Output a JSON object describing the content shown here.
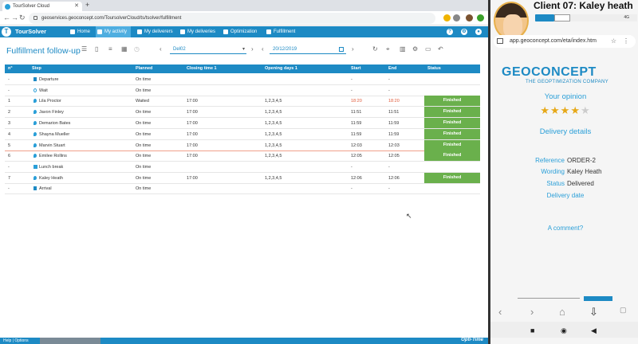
{
  "browser": {
    "tab_title": "TourSolver Cloud",
    "url": "geoservices.geoconcept.com/ToursolverCloud/ts/tsolver/fulfillment"
  },
  "app": {
    "brand": "TourSolver",
    "nav": [
      "Home",
      "My activity",
      "My deliverers",
      "My deliveries",
      "Optimization",
      "Fulfillment"
    ]
  },
  "page": {
    "title": "Fulfillment follow-up",
    "deliverer": "Del02",
    "date": "20/12/2019"
  },
  "table": {
    "headers": [
      "n°",
      "Step",
      "Planned",
      "Closing time 1",
      "Opening days 1",
      "Start",
      "End",
      "Status"
    ],
    "rows": [
      {
        "n": "-",
        "step": "Departure",
        "planned": "On time",
        "closing": "",
        "days": "",
        "start": "-",
        "end": "-",
        "status": ""
      },
      {
        "n": "-",
        "step": "Wait",
        "planned": "On time",
        "closing": "",
        "days": "",
        "start": "-",
        "end": "-",
        "status": ""
      },
      {
        "n": "1",
        "step": "Lila Proctor",
        "planned": "Waited",
        "closing": "17:00",
        "days": "1,2,3,4,5",
        "start": "18:20",
        "end": "18:20",
        "status": "Finished"
      },
      {
        "n": "2",
        "step": "Javon Finley",
        "planned": "On time",
        "closing": "17:00",
        "days": "1,2,3,4,5",
        "start": "11:51",
        "end": "11:51",
        "status": "Finished"
      },
      {
        "n": "3",
        "step": "Demarion Bates",
        "planned": "On time",
        "closing": "17:00",
        "days": "1,2,3,4,5",
        "start": "11:59",
        "end": "11:59",
        "status": "Finished"
      },
      {
        "n": "4",
        "step": "Shayna Mueller",
        "planned": "On time",
        "closing": "17:00",
        "days": "1,2,3,4,5",
        "start": "11:59",
        "end": "11:59",
        "status": "Finished"
      },
      {
        "n": "5",
        "step": "Marvin Stuart",
        "planned": "On time",
        "closing": "17:00",
        "days": "1,2,3,4,5",
        "start": "12:03",
        "end": "12:03",
        "status": "Finished"
      },
      {
        "n": "6",
        "step": "Emilee Rollins",
        "planned": "On time",
        "closing": "17:00",
        "days": "1,2,3,4,5",
        "start": "12:05",
        "end": "12:05",
        "status": "Finished"
      },
      {
        "n": "-",
        "step": "Lunch break",
        "planned": "On time",
        "closing": "",
        "days": "",
        "start": "-",
        "end": "-",
        "status": ""
      },
      {
        "n": "7",
        "step": "Kaley Heath",
        "planned": "On time",
        "closing": "17:00",
        "days": "1,2,3,4,5",
        "start": "12:06",
        "end": "12:06",
        "status": "Finished"
      },
      {
        "n": "-",
        "step": "Arrival",
        "planned": "On time",
        "closing": "",
        "days": "",
        "start": "-",
        "end": "-",
        "status": ""
      }
    ]
  },
  "bottom": {
    "label": "Help | Options",
    "brand": "Opti-Time"
  },
  "phone": {
    "client_title": "Client 07: Kaley heath",
    "url": "app.geoconcept.com/eta/index.htm",
    "logo": "GEOCONCEPT",
    "logo_sub": "THE GEOPTIMIZATION COMPANY",
    "opinion": "Your opinion",
    "rating": 4,
    "rating_max": 5,
    "details_title": "Delivery details",
    "reference_label": "Reference",
    "reference": "ORDER-2",
    "wording_label": "Wording",
    "wording": "Kaley Heath",
    "status_label": "Status",
    "status": "Delivered",
    "delivery_date_label": "Delivery date",
    "comment": "A comment?",
    "status_time": "4G"
  }
}
